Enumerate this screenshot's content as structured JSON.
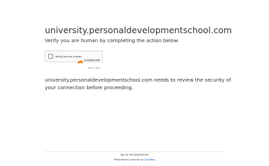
{
  "header": {
    "site": "university.personaldevelopmentschool.com",
    "subtitle": "Verify you are human by completing the action below."
  },
  "challenge": {
    "checkbox_label": "Verify you are human",
    "brand": "CLOUDFLARE",
    "links": "Privacy · Terms"
  },
  "body": {
    "review_text": "university.personaldevelopmentschool.com needs to review the security of your connection before proceeding."
  },
  "footer": {
    "ray_id": "Ray ID: 8d72ad55f5f74f4",
    "performance_prefix": "Performance & security by ",
    "performance_link": "Cloudflare"
  },
  "colors": {
    "cloudflare_orange": "#f38020",
    "link_blue": "#0051c3"
  }
}
